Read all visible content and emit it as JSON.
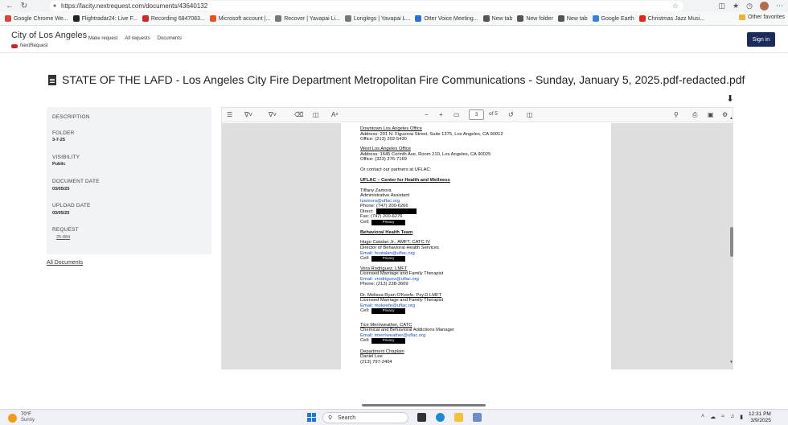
{
  "browser": {
    "url": "https://lacity.nextrequest.com/documents/43640132",
    "bookmarks": [
      {
        "label": "Google Chrome We...",
        "color": "#db4437"
      },
      {
        "label": "Flightradar24: Live F...",
        "color": "#222222"
      },
      {
        "label": "Recording 6847083...",
        "color": "#cc2a2a"
      },
      {
        "label": "Microsoft account |...",
        "color": "#f25022"
      },
      {
        "label": "Recover | Yavapai Li...",
        "color": "#777777"
      },
      {
        "label": "Longlegs | Yavapai L...",
        "color": "#777777"
      },
      {
        "label": "Otter Voice Meeting...",
        "color": "#2a6edb"
      },
      {
        "label": "New tab",
        "color": "#555555"
      },
      {
        "label": "New folder",
        "color": "#555555"
      },
      {
        "label": "New tab",
        "color": "#555555"
      },
      {
        "label": "Google Earth",
        "color": "#3b82d6"
      },
      {
        "label": "Christmas Jazz Musi...",
        "color": "#e0281e"
      }
    ],
    "other_favorites": "Other favorites"
  },
  "header": {
    "brand": "City of Los Angeles",
    "brand_sub": "NextRequest",
    "nav": [
      "Make request",
      "All requests",
      "Documents"
    ],
    "sign_in": "Sign in"
  },
  "document": {
    "title": "STATE OF THE LAFD - Los Angeles City Fire Department Metropolitan Fire Communications - Sunday, January 5, 2025.pdf-redacted.pdf"
  },
  "sidebar": {
    "description_label": "DESCRIPTION",
    "folder_label": "FOLDER",
    "folder_value": "3-7-25",
    "visibility_label": "VISIBILITY",
    "visibility_value": "Public",
    "doc_date_label": "DOCUMENT DATE",
    "doc_date_value": "03/05/25",
    "upload_date_label": "UPLOAD DATE",
    "upload_date_value": "03/05/25",
    "request_label": "REQUEST",
    "request_value": "25-884",
    "all_docs": "All Documents"
  },
  "viewer": {
    "page_current": "3",
    "page_total": "of 5",
    "lines": [
      {
        "text": "Downtown Los Angeles Office",
        "style": "u"
      },
      {
        "text": "Address: 201 N. Figueroa Street, Suite 1375, Los Angeles, CA 90012",
        "style": ""
      },
      {
        "text": "Office: (213) 202-5430",
        "style": ""
      },
      {
        "text": "West Los Angeles Office",
        "style": "u"
      },
      {
        "text": "Address: 1645 Corinth Ave, Room 210, Los Angeles, CA 90025",
        "style": ""
      },
      {
        "text": "Office: (323) 276-7169",
        "style": ""
      },
      {
        "text": "Or contact our partners at UFLAC:",
        "style": ""
      },
      {
        "text": "UFLAC – Center for Health and Wellness",
        "style": "b"
      },
      {
        "text": "Tiffany Zamora",
        "style": ""
      },
      {
        "text": "Administrative Assistant",
        "style": ""
      },
      {
        "text": "tzamora@uflac.org",
        "style": "link"
      },
      {
        "text": "Phone: (747) 200-6266",
        "style": ""
      },
      {
        "text": "Direct:",
        "style": ""
      },
      {
        "text": "Fax: (747) 200-6276",
        "style": ""
      },
      {
        "text": "Cell:",
        "style": ""
      },
      {
        "text": "Behavioral Health Team",
        "style": "b"
      },
      {
        "text": "Hugo Catalan Jr., AMFT, CATC IV",
        "style": "u"
      },
      {
        "text": "Director of Behavioral Health Services",
        "style": ""
      },
      {
        "text": "Email:  hcatalan@uflac.org",
        "style": "link"
      },
      {
        "text": "Cell:",
        "style": ""
      },
      {
        "text": "Vera Rodriguez, LMFT",
        "style": "u"
      },
      {
        "text": "Licensed Marriage and Family Therapist",
        "style": ""
      },
      {
        "text": "Email:  vrodriguez@uflac.org",
        "style": "link"
      },
      {
        "text": "Phone: (213) 238-3609",
        "style": ""
      },
      {
        "text": "Dr. Melissa Ryan O'Keefe, Psy.D LMFT",
        "style": "u"
      },
      {
        "text": "Licensed Marriage and Family Therapist",
        "style": ""
      },
      {
        "text": "Email:  mokeefe@uflac.org",
        "style": "link"
      },
      {
        "text": "Cell:",
        "style": ""
      },
      {
        "text": "Tice Merriweather, CATC",
        "style": "u"
      },
      {
        "text": "Chemical and Behavioral Addictions Manager",
        "style": ""
      },
      {
        "text": "Email:  tmerriweather@uflac.org",
        "style": "link"
      },
      {
        "text": "Cell:",
        "style": ""
      },
      {
        "text": "Department Chaplain",
        "style": "u"
      },
      {
        "text": "Daniel Lee",
        "style": ""
      },
      {
        "text": "(213) 797-2404",
        "style": ""
      }
    ],
    "redaction_label": "Privacy"
  },
  "taskbar": {
    "temp": "70°F",
    "condition": "Sunny",
    "search": "Search",
    "time": "12:31 PM",
    "date": "3/9/2025"
  }
}
